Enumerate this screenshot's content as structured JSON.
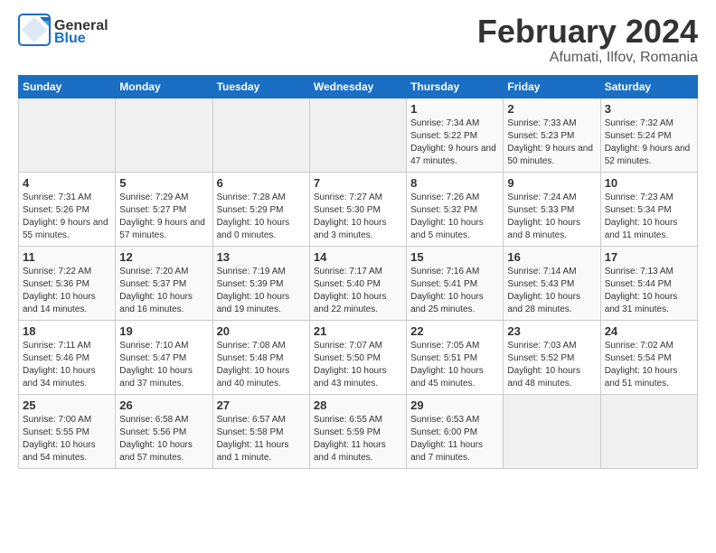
{
  "header": {
    "logo_general": "General",
    "logo_blue": "Blue",
    "month_title": "February 2024",
    "location": "Afumati, Ilfov, Romania"
  },
  "weekdays": [
    "Sunday",
    "Monday",
    "Tuesday",
    "Wednesday",
    "Thursday",
    "Friday",
    "Saturday"
  ],
  "weeks": [
    [
      {
        "day": "",
        "info": ""
      },
      {
        "day": "",
        "info": ""
      },
      {
        "day": "",
        "info": ""
      },
      {
        "day": "",
        "info": ""
      },
      {
        "day": "1",
        "info": "Sunrise: 7:34 AM\nSunset: 5:22 PM\nDaylight: 9 hours and 47 minutes."
      },
      {
        "day": "2",
        "info": "Sunrise: 7:33 AM\nSunset: 5:23 PM\nDaylight: 9 hours and 50 minutes."
      },
      {
        "day": "3",
        "info": "Sunrise: 7:32 AM\nSunset: 5:24 PM\nDaylight: 9 hours and 52 minutes."
      }
    ],
    [
      {
        "day": "4",
        "info": "Sunrise: 7:31 AM\nSunset: 5:26 PM\nDaylight: 9 hours and 55 minutes."
      },
      {
        "day": "5",
        "info": "Sunrise: 7:29 AM\nSunset: 5:27 PM\nDaylight: 9 hours and 57 minutes."
      },
      {
        "day": "6",
        "info": "Sunrise: 7:28 AM\nSunset: 5:29 PM\nDaylight: 10 hours and 0 minutes."
      },
      {
        "day": "7",
        "info": "Sunrise: 7:27 AM\nSunset: 5:30 PM\nDaylight: 10 hours and 3 minutes."
      },
      {
        "day": "8",
        "info": "Sunrise: 7:26 AM\nSunset: 5:32 PM\nDaylight: 10 hours and 5 minutes."
      },
      {
        "day": "9",
        "info": "Sunrise: 7:24 AM\nSunset: 5:33 PM\nDaylight: 10 hours and 8 minutes."
      },
      {
        "day": "10",
        "info": "Sunrise: 7:23 AM\nSunset: 5:34 PM\nDaylight: 10 hours and 11 minutes."
      }
    ],
    [
      {
        "day": "11",
        "info": "Sunrise: 7:22 AM\nSunset: 5:36 PM\nDaylight: 10 hours and 14 minutes."
      },
      {
        "day": "12",
        "info": "Sunrise: 7:20 AM\nSunset: 5:37 PM\nDaylight: 10 hours and 16 minutes."
      },
      {
        "day": "13",
        "info": "Sunrise: 7:19 AM\nSunset: 5:39 PM\nDaylight: 10 hours and 19 minutes."
      },
      {
        "day": "14",
        "info": "Sunrise: 7:17 AM\nSunset: 5:40 PM\nDaylight: 10 hours and 22 minutes."
      },
      {
        "day": "15",
        "info": "Sunrise: 7:16 AM\nSunset: 5:41 PM\nDaylight: 10 hours and 25 minutes."
      },
      {
        "day": "16",
        "info": "Sunrise: 7:14 AM\nSunset: 5:43 PM\nDaylight: 10 hours and 28 minutes."
      },
      {
        "day": "17",
        "info": "Sunrise: 7:13 AM\nSunset: 5:44 PM\nDaylight: 10 hours and 31 minutes."
      }
    ],
    [
      {
        "day": "18",
        "info": "Sunrise: 7:11 AM\nSunset: 5:46 PM\nDaylight: 10 hours and 34 minutes."
      },
      {
        "day": "19",
        "info": "Sunrise: 7:10 AM\nSunset: 5:47 PM\nDaylight: 10 hours and 37 minutes."
      },
      {
        "day": "20",
        "info": "Sunrise: 7:08 AM\nSunset: 5:48 PM\nDaylight: 10 hours and 40 minutes."
      },
      {
        "day": "21",
        "info": "Sunrise: 7:07 AM\nSunset: 5:50 PM\nDaylight: 10 hours and 43 minutes."
      },
      {
        "day": "22",
        "info": "Sunrise: 7:05 AM\nSunset: 5:51 PM\nDaylight: 10 hours and 45 minutes."
      },
      {
        "day": "23",
        "info": "Sunrise: 7:03 AM\nSunset: 5:52 PM\nDaylight: 10 hours and 48 minutes."
      },
      {
        "day": "24",
        "info": "Sunrise: 7:02 AM\nSunset: 5:54 PM\nDaylight: 10 hours and 51 minutes."
      }
    ],
    [
      {
        "day": "25",
        "info": "Sunrise: 7:00 AM\nSunset: 5:55 PM\nDaylight: 10 hours and 54 minutes."
      },
      {
        "day": "26",
        "info": "Sunrise: 6:58 AM\nSunset: 5:56 PM\nDaylight: 10 hours and 57 minutes."
      },
      {
        "day": "27",
        "info": "Sunrise: 6:57 AM\nSunset: 5:58 PM\nDaylight: 11 hours and 1 minute."
      },
      {
        "day": "28",
        "info": "Sunrise: 6:55 AM\nSunset: 5:59 PM\nDaylight: 11 hours and 4 minutes."
      },
      {
        "day": "29",
        "info": "Sunrise: 6:53 AM\nSunset: 6:00 PM\nDaylight: 11 hours and 7 minutes."
      },
      {
        "day": "",
        "info": ""
      },
      {
        "day": "",
        "info": ""
      }
    ]
  ]
}
